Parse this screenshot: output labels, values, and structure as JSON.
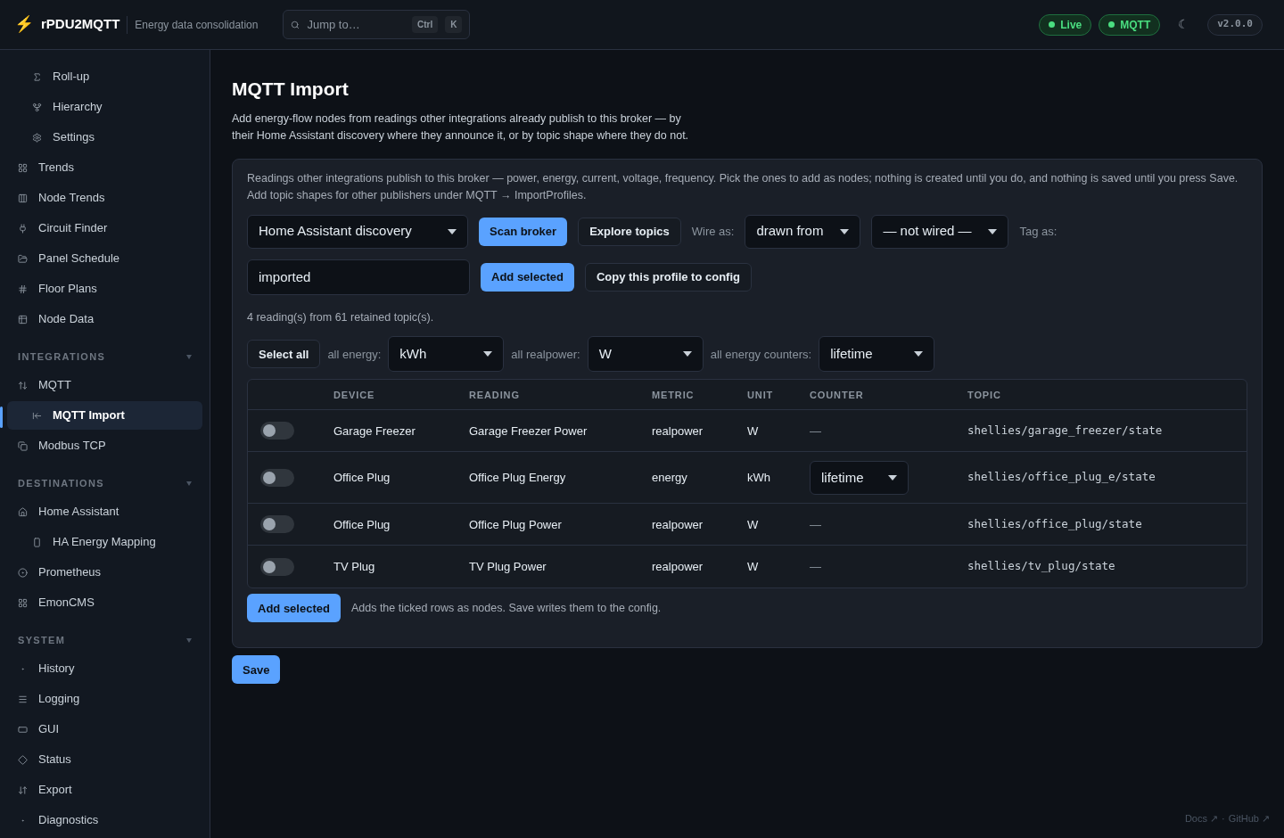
{
  "header": {
    "logo": "⚡",
    "app_name": "rPDU2MQTT",
    "tagline": "Energy data consolidation",
    "search": {
      "placeholder": "Jump to…",
      "keys": [
        "Ctrl",
        "K"
      ]
    },
    "badges": [
      {
        "label": "Live",
        "color": "#4ade80"
      },
      {
        "label": "MQTT",
        "color": "#4ade80"
      }
    ],
    "theme_toggle": "☾",
    "version": "v2.0.0"
  },
  "sidebar": {
    "sections": [
      {
        "items": [
          {
            "label": "Roll-up",
            "kind": "sub",
            "selected": false
          },
          {
            "label": "Hierarchy",
            "kind": "sub",
            "selected": false
          },
          {
            "label": "Settings",
            "kind": "sub",
            "selected": false
          },
          {
            "label": "Trends",
            "kind": "top",
            "selected": false
          },
          {
            "label": "Node Trends",
            "kind": "top",
            "selected": false
          },
          {
            "label": "Circuit Finder",
            "kind": "top",
            "selected": false
          },
          {
            "label": "Panel Schedule",
            "kind": "top",
            "selected": false
          },
          {
            "label": "Floor Plans",
            "kind": "top",
            "selected": false
          },
          {
            "label": "Node Data",
            "kind": "top",
            "selected": false
          }
        ]
      },
      {
        "title": "INTEGRATIONS",
        "expanded": true,
        "items": [
          {
            "label": "MQTT",
            "kind": "top",
            "selected": false
          },
          {
            "label": "MQTT Import",
            "kind": "sub",
            "selected": true
          },
          {
            "label": "Modbus TCP",
            "kind": "top",
            "selected": false
          }
        ]
      },
      {
        "title": "DESTINATIONS",
        "expanded": true,
        "items": [
          {
            "label": "Home Assistant",
            "kind": "top",
            "selected": false
          },
          {
            "label": "HA Energy Mapping",
            "kind": "sub",
            "selected": false
          },
          {
            "label": "Prometheus",
            "kind": "top",
            "selected": false
          },
          {
            "label": "EmonCMS",
            "kind": "top",
            "selected": false
          }
        ]
      },
      {
        "title": "SYSTEM",
        "expanded": true,
        "items": [
          {
            "label": "History",
            "kind": "top",
            "selected": false
          },
          {
            "label": "Logging",
            "kind": "top",
            "selected": false
          },
          {
            "label": "GUI",
            "kind": "top",
            "selected": false
          },
          {
            "label": "Status",
            "kind": "top",
            "selected": false
          },
          {
            "label": "Export",
            "kind": "top",
            "selected": false
          },
          {
            "label": "Diagnostics",
            "kind": "top",
            "selected": false
          }
        ]
      }
    ]
  },
  "page": {
    "title": "MQTT Import",
    "description": "Add energy-flow nodes from readings other integrations already publish to this broker — by their Home Assistant discovery where they announce it, or by topic shape where they do not.",
    "card": {
      "intro": [
        "Readings other integrations publish to this broker — power, energy, current, voltage, frequency. Pick the ones to add as nodes; nothing is created until you do, and nothing is saved until you press Save.",
        "Add topic shapes for other publishers under MQTT → ImportProfiles."
      ],
      "source_select": "Home Assistant discovery",
      "scan_button": "Scan broker",
      "explore_button": "Explore topics",
      "wire_label": "Wire as:",
      "wire_select": "drawn from",
      "wire_target_select": "— not wired —",
      "tag_label": "Tag as:",
      "tag_value": "imported",
      "add_button": "Add selected",
      "copy_button": "Copy this profile to config",
      "summary": "4 reading(s) from 61 retained topic(s).",
      "select_all": "Select all",
      "energy_label": "all energy:",
      "energy_select": "kWh",
      "power_label": "all realpower:",
      "power_select": "W",
      "counters_label": "all energy counters:",
      "counters_select": "lifetime",
      "table": {
        "columns": [
          "DEVICE",
          "READING",
          "METRIC",
          "UNIT",
          "COUNTER",
          "TOPIC"
        ],
        "rows": [
          {
            "on": false,
            "device": "Garage Freezer",
            "reading": "Garage Freezer Power",
            "metric": "realpower",
            "unit": "W",
            "counter": {
              "kind": "text",
              "value": "—"
            },
            "topic": "shellies/garage_freezer/state"
          },
          {
            "on": false,
            "device": "Office Plug",
            "reading": "Office Plug Energy",
            "metric": "energy",
            "unit": "kWh",
            "counter": {
              "kind": "select",
              "value": "lifetime"
            },
            "topic": "shellies/office_plug_e/state"
          },
          {
            "on": false,
            "device": "Office Plug",
            "reading": "Office Plug Power",
            "metric": "realpower",
            "unit": "W",
            "counter": {
              "kind": "text",
              "value": "—"
            },
            "topic": "shellies/office_plug/state"
          },
          {
            "on": false,
            "device": "TV Plug",
            "reading": "TV Plug Power",
            "metric": "realpower",
            "unit": "W",
            "counter": {
              "kind": "text",
              "value": "—"
            },
            "topic": "shellies/tv_plug/state"
          }
        ]
      },
      "footer_button": "Add selected",
      "footer_note": "Adds the ticked rows as nodes. Save writes them to the config."
    },
    "save_button": "Save"
  },
  "footer_links": [
    "Docs ↗",
    "·",
    "GitHub ↗"
  ]
}
